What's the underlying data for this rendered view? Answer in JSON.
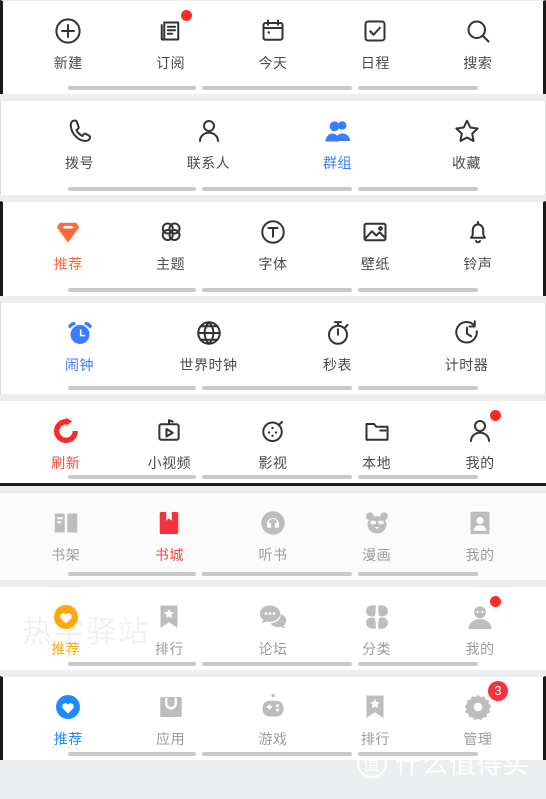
{
  "page": {
    "background_color": "#ebedef",
    "row_background": "#ffffff"
  },
  "colors": {
    "ink": "#333333",
    "label": "#4a4a4a",
    "muted": "#bdbdbd",
    "blue": "#3a7bff",
    "blue_alt": "#1a8cff",
    "red": "#fb2b2b",
    "red_deep": "#f5333f",
    "orange": "#fe6a3c",
    "amber": "#ffa60a",
    "badge_red": "#f5333f"
  },
  "rows": [
    {
      "id": "notes-tabbar",
      "name": "notes-tab-bar",
      "style": "edge-dark",
      "tabs": [
        {
          "label": "新建",
          "icon": "plus-circle-icon",
          "state": "inactive",
          "badge": null
        },
        {
          "label": "订阅",
          "icon": "newspaper-icon",
          "state": "inactive",
          "badge": "dot"
        },
        {
          "label": "今天",
          "icon": "calendar-icon",
          "state": "inactive",
          "badge": null
        },
        {
          "label": "日程",
          "icon": "checkbox-icon",
          "state": "inactive",
          "badge": null
        },
        {
          "label": "搜索",
          "icon": "search-icon",
          "state": "inactive",
          "badge": null
        }
      ]
    },
    {
      "id": "phone-tabbar",
      "name": "phone-tab-bar",
      "style": "edge-light",
      "tabs": [
        {
          "label": "拨号",
          "icon": "phone-handset-icon",
          "state": "inactive",
          "badge": null
        },
        {
          "label": "联系人",
          "icon": "person-outline-icon",
          "state": "inactive",
          "badge": null
        },
        {
          "label": "群组",
          "icon": "people-group-icon",
          "state": "active-blue",
          "badge": null
        },
        {
          "label": "收藏",
          "icon": "star-outline-icon",
          "state": "inactive",
          "badge": null
        }
      ]
    },
    {
      "id": "theme-tabbar",
      "name": "theme-store-tab-bar",
      "style": "edge-dark",
      "tabs": [
        {
          "label": "推荐",
          "icon": "diamond-icon",
          "state": "active-orange",
          "badge": null
        },
        {
          "label": "主题",
          "icon": "theme-circles-icon",
          "state": "inactive",
          "badge": null
        },
        {
          "label": "字体",
          "icon": "font-t-icon",
          "state": "inactive",
          "badge": null
        },
        {
          "label": "壁纸",
          "icon": "image-icon",
          "state": "inactive",
          "badge": null
        },
        {
          "label": "铃声",
          "icon": "bell-icon",
          "state": "inactive",
          "badge": null
        }
      ]
    },
    {
      "id": "clock-tabbar",
      "name": "clock-tab-bar",
      "style": "edge-light",
      "tabs": [
        {
          "label": "闹钟",
          "icon": "alarm-clock-icon",
          "state": "active-blue",
          "badge": null
        },
        {
          "label": "世界时钟",
          "icon": "globe-icon",
          "state": "inactive",
          "badge": null
        },
        {
          "label": "秒表",
          "icon": "stopwatch-icon",
          "state": "inactive",
          "badge": null
        },
        {
          "label": "计时器",
          "icon": "timer-icon",
          "state": "inactive",
          "badge": null
        }
      ]
    },
    {
      "id": "video-tabbar",
      "name": "video-app-tab-bar",
      "style": "bot-dark",
      "tabs": [
        {
          "label": "刷新",
          "icon": "refresh-icon",
          "state": "active-red",
          "badge": null
        },
        {
          "label": "小视频",
          "icon": "tv-play-icon",
          "state": "inactive",
          "badge": null
        },
        {
          "label": "影视",
          "icon": "film-reel-icon",
          "state": "inactive",
          "badge": null
        },
        {
          "label": "本地",
          "icon": "folder-icon",
          "state": "inactive",
          "badge": null
        },
        {
          "label": "我的",
          "icon": "person-outline-icon",
          "state": "inactive",
          "badge": "dot"
        }
      ]
    },
    {
      "id": "reader-tabbar",
      "name": "reader-app-tab-bar",
      "style": "tint",
      "tabs": [
        {
          "label": "书架",
          "icon": "open-book-icon",
          "state": "inactive-solid",
          "badge": null
        },
        {
          "label": "书城",
          "icon": "bookmark-solid-icon",
          "state": "active-red-solid",
          "badge": null
        },
        {
          "label": "听书",
          "icon": "headphones-icon",
          "state": "inactive-solid",
          "badge": null
        },
        {
          "label": "漫画",
          "icon": "panda-icon",
          "state": "inactive-solid",
          "badge": null
        },
        {
          "label": "我的",
          "icon": "contact-card-icon",
          "state": "inactive-solid",
          "badge": null
        }
      ]
    },
    {
      "id": "novel-tabbar",
      "name": "novel-app-tab-bar",
      "style": "plain",
      "watermark": "热字驿站",
      "tabs": [
        {
          "label": "推荐",
          "icon": "heart-circle-icon",
          "state": "active-amber-solid",
          "badge": null
        },
        {
          "label": "排行",
          "icon": "bookmark-star-icon",
          "state": "inactive-solid",
          "badge": null
        },
        {
          "label": "论坛",
          "icon": "chat-bubbles-icon",
          "state": "inactive-solid",
          "badge": null
        },
        {
          "label": "分类",
          "icon": "grid-four-icon",
          "state": "inactive-solid",
          "badge": null
        },
        {
          "label": "我的",
          "icon": "avatar-icon",
          "state": "inactive-solid",
          "badge": "dot"
        }
      ]
    },
    {
      "id": "appstore-tabbar",
      "name": "app-store-tab-bar",
      "style": "edge-dark",
      "tabs": [
        {
          "label": "推荐",
          "icon": "heart-circle-icon",
          "state": "active-blue-solid",
          "badge": null
        },
        {
          "label": "应用",
          "icon": "shopping-bag-icon",
          "state": "inactive-solid",
          "badge": null
        },
        {
          "label": "游戏",
          "icon": "game-robot-icon",
          "state": "inactive-solid",
          "badge": null
        },
        {
          "label": "排行",
          "icon": "bookmark-star-icon",
          "state": "inactive-solid",
          "badge": null
        },
        {
          "label": "管理",
          "icon": "gear-icon",
          "state": "inactive-solid",
          "badge": "3"
        }
      ]
    }
  ],
  "watermark": {
    "logo_char": "值",
    "text": "什么值得买"
  }
}
